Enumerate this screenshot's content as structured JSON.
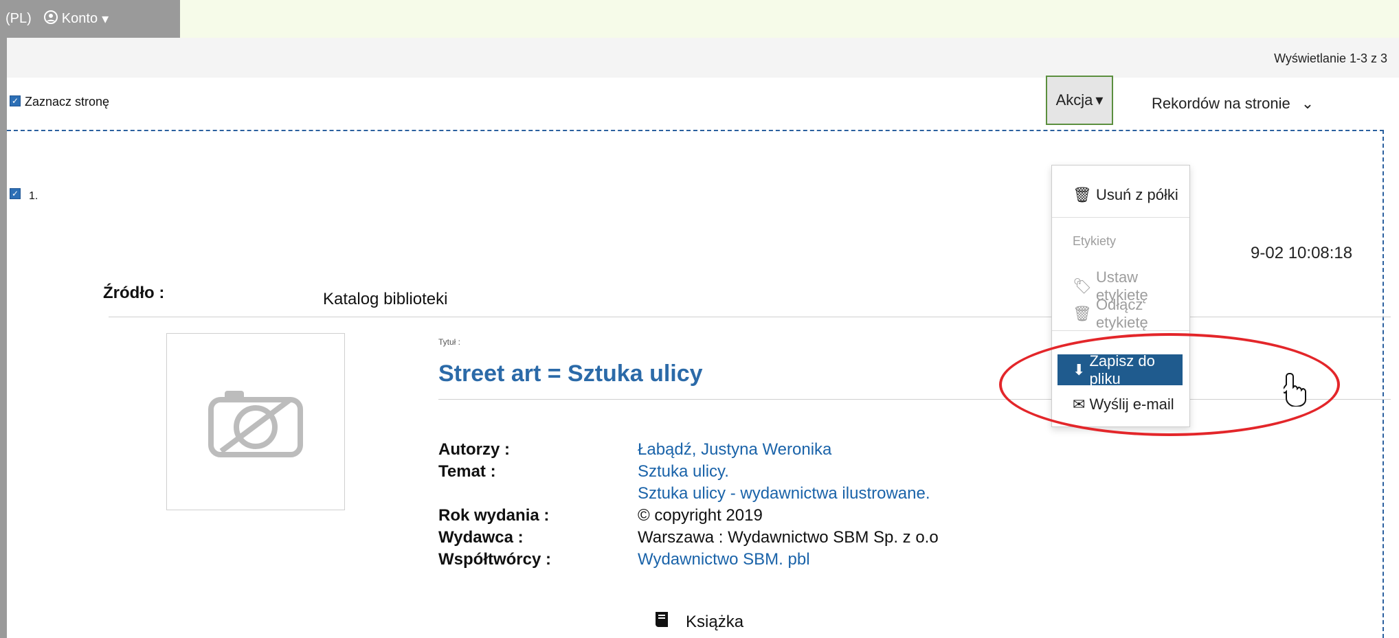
{
  "top_bar": {
    "language": "(PL)",
    "account": "Konto"
  },
  "results": {
    "count_text": "Wyświetlanie 1-3 z 3"
  },
  "select": {
    "label": "Zaznacz stronę"
  },
  "record": {
    "number": "1.",
    "timestamp": "9-02 10:08:18",
    "source_label": "Źródło :",
    "source_value": "Katalog biblioteki",
    "title_label": "Tytuł :",
    "title": "Street art = Sztuka ulicy",
    "authors_label": "Autorzy :",
    "authors": "Łabądź, Justyna Weronika",
    "subject_label": "Temat :",
    "subject_1": "Sztuka ulicy.",
    "subject_2": "Sztuka ulicy - wydawnictwa ilustrowane.",
    "year_label": "Rok wydania :",
    "year": "© copyright 2019",
    "publisher_label": "Wydawca :",
    "publisher": "Warszawa : Wydawnictwo SBM Sp. z o.o",
    "contributors_label": "Współtwórcy :",
    "contributors": "Wydawnictwo SBM. pbl",
    "format": "Książka"
  },
  "actions": {
    "button": "Akcja",
    "per_page": "Rekordów na stronie",
    "menu": {
      "remove": "Usuń z półki",
      "tags_header": "Etykiety",
      "set_tag": "Ustaw etykietę",
      "detach_tag": "Odłącz etykietę",
      "save_file": "Zapisz do pliku",
      "send_email": "Wyślij e-mail"
    }
  },
  "colors": {
    "accent": "#2b6aa8",
    "highlight": "#1f5b8e",
    "annotation": "#e3262a",
    "background": "#f6fbe9"
  }
}
